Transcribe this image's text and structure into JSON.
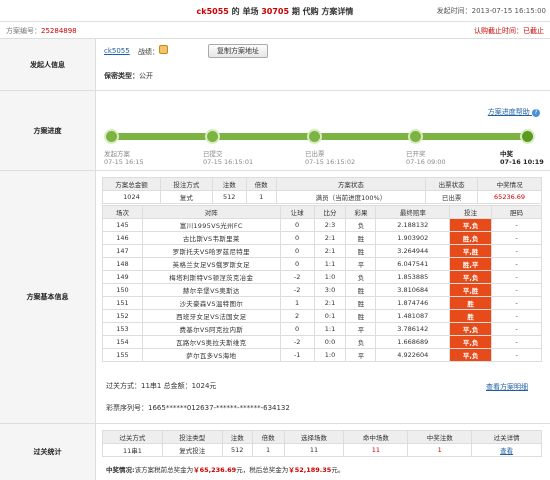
{
  "header": {
    "user": "ck5055",
    "mid1": " 的 单场 ",
    "period": "30705",
    "mid2": " 期 代购 方案详情",
    "time": "发起时间：2013-07-15 16:15:00"
  },
  "subheader": {
    "plan_no_label": "方案编号：",
    "plan_no": "25284898",
    "deadline": "认购截止时间：已截止"
  },
  "initiator": {
    "section_label": "发起人信息",
    "user": "ck5055",
    "record_label": "战绩：",
    "copy_button": "复制方案地址",
    "privacy": "保密类型：",
    "privacy_value": "公开"
  },
  "progress": {
    "section_label": "方案进度",
    "help": "方案进度帮助",
    "steps": [
      {
        "name": "发起方案",
        "time": "07-15 16:15"
      },
      {
        "name": "已提交",
        "time": "07-15 16:15:01"
      },
      {
        "name": "已出票",
        "time": "07-15 16:15:02"
      },
      {
        "name": "已开奖",
        "time": "07-16 09:00"
      },
      {
        "name": "中奖",
        "time": "07-16 10:19"
      }
    ]
  },
  "basic": {
    "section_label": "方案基本信息",
    "summary_headers": [
      "方案总金额",
      "投注方式",
      "注数",
      "倍数",
      "方案状态",
      "出票状态",
      "中奖情况"
    ],
    "summary_row": [
      "1024",
      "复式",
      "512",
      "1",
      "满员（当前进度100%）",
      "已出票",
      "65236.69"
    ],
    "match_headers": [
      "场次",
      "对阵",
      "让球",
      "比分",
      "彩果",
      "最终赔率",
      "投注",
      "胆码"
    ],
    "matches": [
      {
        "no": "145",
        "vs": "富川1995VS光州FC",
        "hc": "0",
        "score": "2:3",
        "res": "负",
        "odds": "2.188132",
        "bet": "平,负",
        "dan": "-"
      },
      {
        "no": "146",
        "vs": "古比斯VS韦斯里莱",
        "hc": "0",
        "score": "2:1",
        "res": "胜",
        "odds": "1.903902",
        "bet": "胜,负",
        "dan": "-"
      },
      {
        "no": "147",
        "vs": "罗斯托夫VS哈罗兹尼特里",
        "hc": "0",
        "score": "2:1",
        "res": "胜",
        "odds": "3.264944",
        "bet": "平,胜",
        "dan": "-"
      },
      {
        "no": "148",
        "vs": "英格兰女足VS俄罗斯女足",
        "hc": "0",
        "score": "1:1",
        "res": "平",
        "odds": "6.047541",
        "bet": "胜,平",
        "dan": "-"
      },
      {
        "no": "149",
        "vs": "梅塔利斯特VS顿涅茨克冶金",
        "hc": "-2",
        "score": "1:0",
        "res": "负",
        "odds": "1.853885",
        "bet": "平,负",
        "dan": "-"
      },
      {
        "no": "150",
        "vs": "赫尔辛堡VS奥斯达",
        "hc": "-2",
        "score": "3:0",
        "res": "胜",
        "odds": "3.810684",
        "bet": "平,胜",
        "dan": "-"
      },
      {
        "no": "151",
        "vs": "沙夫豪森VS温特图尔",
        "hc": "1",
        "score": "2:1",
        "res": "胜",
        "odds": "1.874746",
        "bet": "胜",
        "dan": "-"
      },
      {
        "no": "152",
        "vs": "西班牙女足VS法国女足",
        "hc": "2",
        "score": "0:1",
        "res": "胜",
        "odds": "1.481087",
        "bet": "胜",
        "dan": "-"
      },
      {
        "no": "153",
        "vs": "费基尔VS阿克拉内斯",
        "hc": "0",
        "score": "1:1",
        "res": "平",
        "odds": "3.786142",
        "bet": "平,负",
        "dan": "-"
      },
      {
        "no": "154",
        "vs": "瓦路尔VS奥拉夫斯维克",
        "hc": "-2",
        "score": "0:0",
        "res": "负",
        "odds": "1.668689",
        "bet": "平,负",
        "dan": "-"
      },
      {
        "no": "155",
        "vs": "萨尔瓦多VS海地",
        "hc": "-1",
        "score": "1:0",
        "res": "平",
        "odds": "4.922604",
        "bet": "平,负",
        "dan": "-"
      }
    ],
    "pass_method": "过关方式：11串1 总金额：1024元",
    "view_detail": "查看方案明细",
    "serial": "彩票序列号：1665******012637-******-******-634132"
  },
  "pass_stats": {
    "section_label": "过关统计",
    "headers": [
      "过关方式",
      "投注类型",
      "注数",
      "倍数",
      "选择场数",
      "命中场数",
      "中奖注数",
      "过关详情"
    ],
    "row": [
      "11串1",
      "复式投注",
      "512",
      "1",
      "11",
      "11",
      "1",
      "查看"
    ],
    "win_label": "中奖情况:",
    "win_text1": "该方案税前总奖金为",
    "win_pre": "￥65,236.69",
    "win_text2": "元，税后总奖金为",
    "win_post": "￥52,189.35",
    "win_text3": "元。"
  },
  "colors": {
    "accent_red": "#cc0000",
    "progress_green": "#7cb342",
    "result_orange": "#e84b1a"
  }
}
